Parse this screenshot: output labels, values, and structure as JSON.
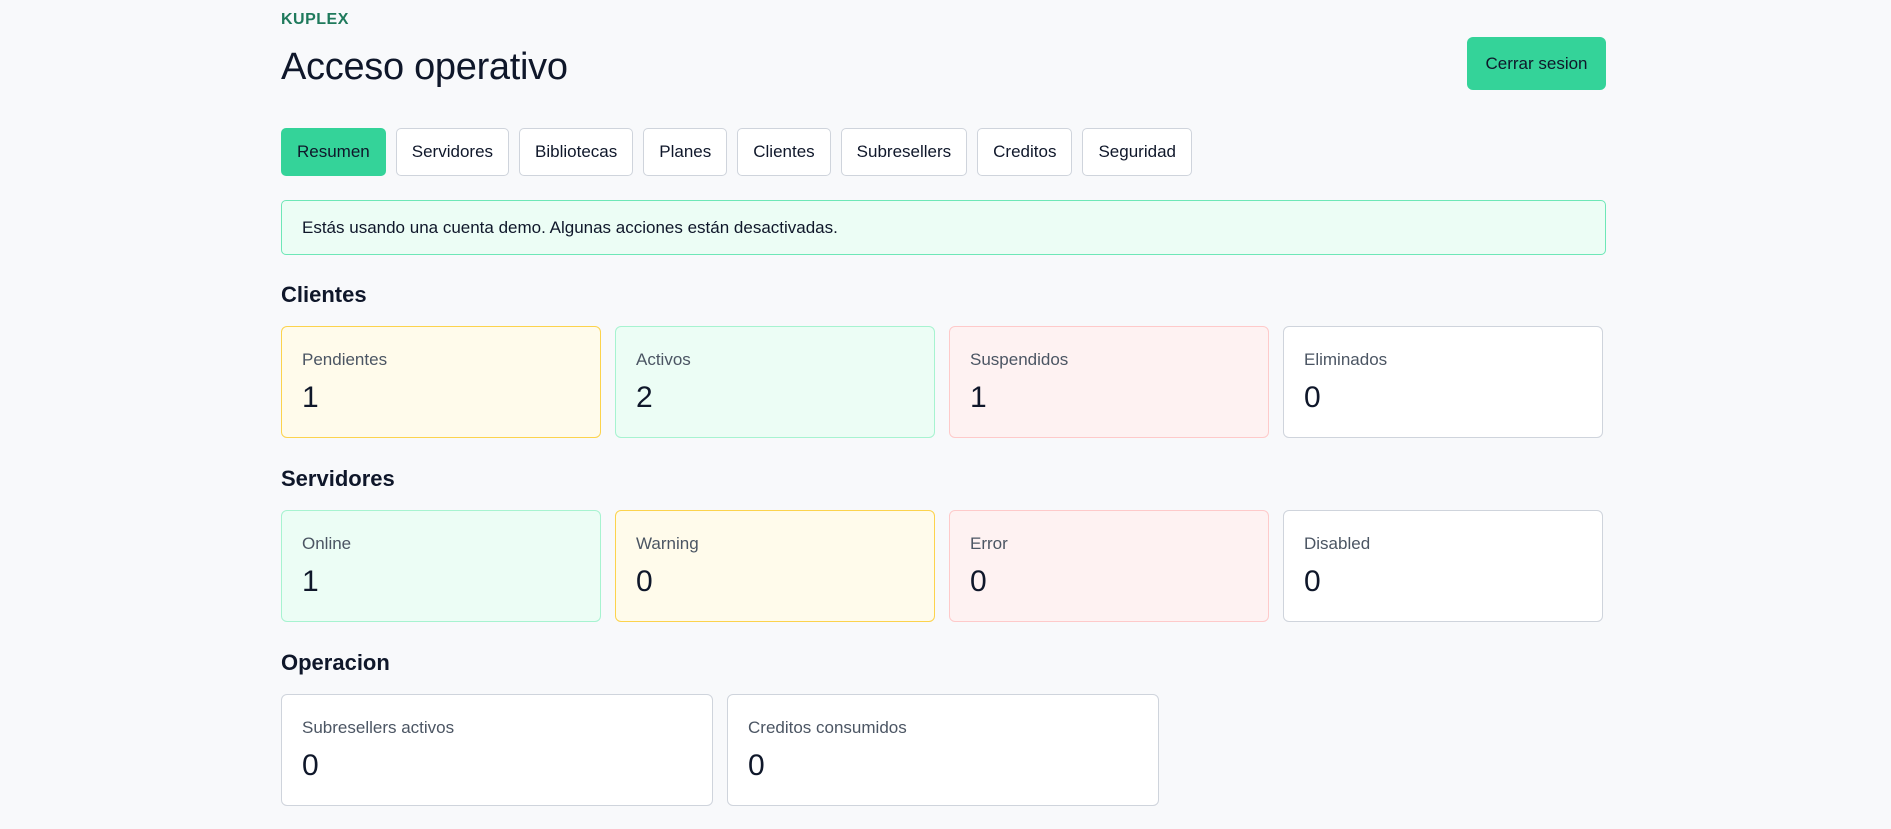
{
  "header": {
    "brand": "KUPLEX",
    "title": "Acceso operativo",
    "logout_label": "Cerrar sesion"
  },
  "tabs": [
    {
      "label": "Resumen",
      "active": true
    },
    {
      "label": "Servidores"
    },
    {
      "label": "Bibliotecas"
    },
    {
      "label": "Planes"
    },
    {
      "label": "Clientes"
    },
    {
      "label": "Subresellers"
    },
    {
      "label": "Creditos"
    },
    {
      "label": "Seguridad"
    }
  ],
  "notice": "Estás usando una cuenta demo. Algunas acciones están desactivadas.",
  "clientes": {
    "title": "Clientes",
    "cards": [
      {
        "label": "Pendientes",
        "value": "1"
      },
      {
        "label": "Activos",
        "value": "2"
      },
      {
        "label": "Suspendidos",
        "value": "1"
      },
      {
        "label": "Eliminados",
        "value": "0"
      }
    ]
  },
  "servidores": {
    "title": "Servidores",
    "cards": [
      {
        "label": "Online",
        "value": "1"
      },
      {
        "label": "Warning",
        "value": "0"
      },
      {
        "label": "Error",
        "value": "0"
      },
      {
        "label": "Disabled",
        "value": "0"
      }
    ]
  },
  "operacion": {
    "title": "Operacion",
    "cards": [
      {
        "label": "Subresellers activos",
        "value": "0"
      },
      {
        "label": "Creditos consumidos",
        "value": "0"
      }
    ]
  },
  "colors": {
    "accent": "#34d399",
    "pending": "#fffbeb",
    "active": "#ecfdf5",
    "suspended": "#fef2f2"
  }
}
